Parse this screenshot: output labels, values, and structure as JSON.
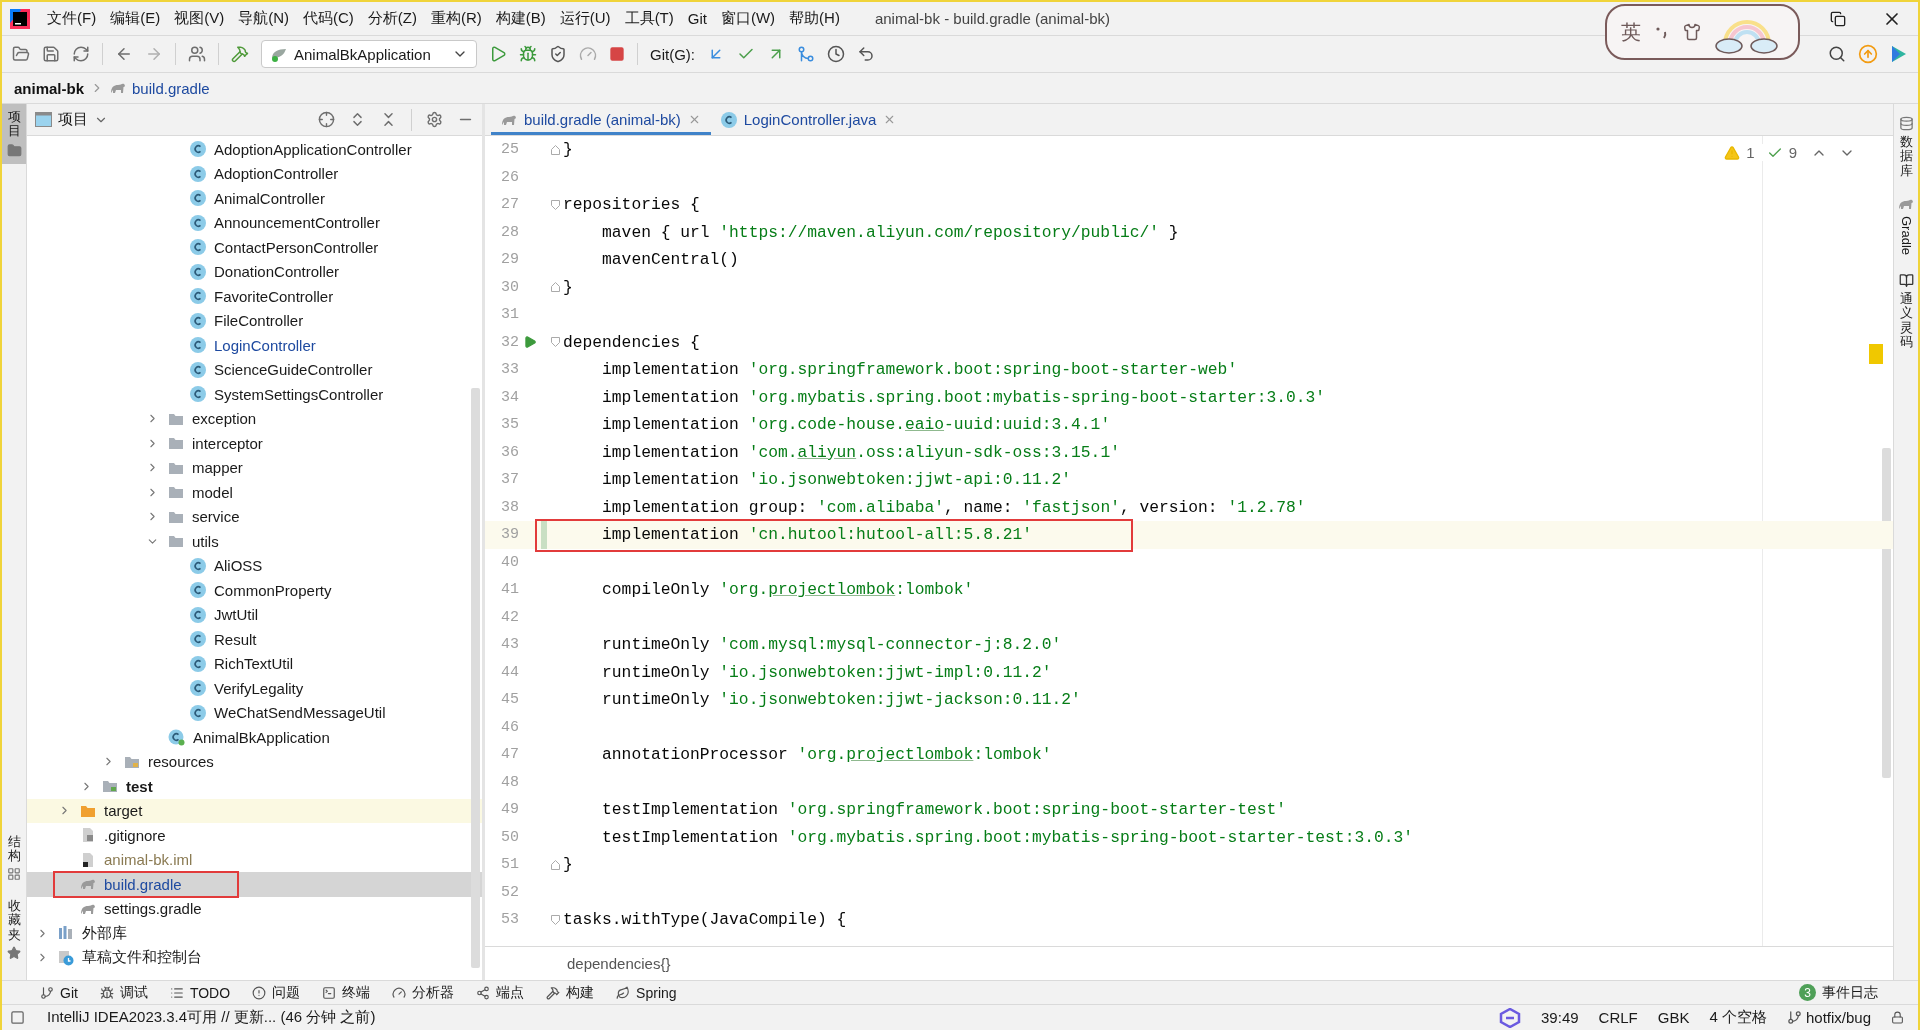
{
  "window": {
    "title": "animal-bk - build.gradle (animal-bk)"
  },
  "menu": [
    "文件(F)",
    "编辑(E)",
    "视图(V)",
    "导航(N)",
    "代码(C)",
    "分析(Z)",
    "重构(R)",
    "构建(B)",
    "运行(U)",
    "工具(T)",
    "Git",
    "窗口(W)",
    "帮助(H)"
  ],
  "ime": {
    "label": "英"
  },
  "toolbar": {
    "run_config": "AnimalBkApplication",
    "git_label": "Git(G):"
  },
  "breadcrumb": [
    "animal-bk",
    "build.gradle"
  ],
  "left_tool_windows": [
    {
      "label": "项目",
      "selected": true
    },
    {
      "label": "结构",
      "selected": false
    },
    {
      "label": "收藏夹",
      "selected": false
    }
  ],
  "right_tool_windows": [
    {
      "label": "数据库",
      "kind": "cjk"
    },
    {
      "label": "Gradle",
      "kind": "latin"
    },
    {
      "label": "通义灵码",
      "kind": "cjk"
    }
  ],
  "project_panel": {
    "title": "项目",
    "tree": [
      {
        "kind": "hidden",
        "children": [
          {
            "kind": "hidden",
            "children": [
              {
                "kind": "hidden",
                "children": [
                  {
                    "kind": "hidden",
                    "children": [
                      {
                        "kind": "hidden",
                        "children": [
                          {
                            "kind": "hidden",
                            "children": [
                              {
                                "label": "AdoptionApplicationController",
                                "kind": "class",
                                "selected": false
                              },
                              {
                                "label": "AdoptionController",
                                "kind": "class",
                                "selected": false
                              },
                              {
                                "label": "AnimalController",
                                "kind": "class",
                                "selected": false
                              },
                              {
                                "label": "AnnouncementController",
                                "kind": "class",
                                "selected": false
                              },
                              {
                                "label": "ContactPersonController",
                                "kind": "class",
                                "selected": false
                              },
                              {
                                "label": "DonationController",
                                "kind": "class",
                                "selected": false
                              },
                              {
                                "label": "FavoriteController",
                                "kind": "class",
                                "selected": false
                              },
                              {
                                "label": "FileController",
                                "kind": "class",
                                "selected": false
                              },
                              {
                                "label": "LoginController",
                                "kind": "class",
                                "selected": false,
                                "color": "#1e4aa0"
                              },
                              {
                                "label": "ScienceGuideController",
                                "kind": "class",
                                "selected": false
                              },
                              {
                                "label": "SystemSettingsController",
                                "kind": "class",
                                "selected": false
                              }
                            ]
                          },
                          {
                            "label": "exception",
                            "kind": "package",
                            "expanded": false,
                            "selected": false
                          },
                          {
                            "label": "interceptor",
                            "kind": "package",
                            "expanded": false,
                            "selected": false
                          },
                          {
                            "label": "mapper",
                            "kind": "package",
                            "expanded": false,
                            "selected": false
                          },
                          {
                            "label": "model",
                            "kind": "package",
                            "expanded": false,
                            "selected": false
                          },
                          {
                            "label": "service",
                            "kind": "package",
                            "expanded": false,
                            "selected": false
                          },
                          {
                            "label": "utils",
                            "kind": "package",
                            "expanded": true,
                            "selected": false,
                            "children": [
                              {
                                "label": "AliOSS",
                                "kind": "class",
                                "selected": false
                              },
                              {
                                "label": "CommonProperty",
                                "kind": "class",
                                "selected": false
                              },
                              {
                                "label": "JwtUtil",
                                "kind": "class",
                                "selected": false
                              },
                              {
                                "label": "Result",
                                "kind": "class",
                                "selected": false
                              },
                              {
                                "label": "RichTextUtil",
                                "kind": "class",
                                "selected": false
                              },
                              {
                                "label": "VerifyLegality",
                                "kind": "class",
                                "selected": false
                              },
                              {
                                "label": "WeChatSendMessageUtil",
                                "kind": "class",
                                "selected": false
                              }
                            ]
                          },
                          {
                            "label": "AnimalBkApplication",
                            "kind": "app_class",
                            "selected": false
                          }
                        ]
                      }
                    ]
                  },
                  {
                    "label": "resources",
                    "kind": "resources_folder",
                    "expanded": false,
                    "selected": false
                  }
                ]
              },
              {
                "label": "test",
                "kind": "test_folder",
                "expanded": false,
                "selected": false
              }
            ]
          },
          {
            "label": "target",
            "kind": "excluded_folder",
            "expanded": false,
            "selected": false
          },
          {
            "label": ".gitignore",
            "kind": "file",
            "selected": false
          },
          {
            "label": "animal-bk.iml",
            "kind": "module_file",
            "selected": false,
            "color": "#8a7a52"
          },
          {
            "label": "build.gradle",
            "kind": "gradle_file",
            "selected": true,
            "color": "#1e4aa0",
            "annotated": true
          },
          {
            "label": "settings.gradle",
            "kind": "gradle_file",
            "selected": false
          }
        ]
      },
      {
        "label": "外部库",
        "kind": "library",
        "expanded": false,
        "selected": false
      },
      {
        "label": "草稿文件和控制台",
        "kind": "scratch",
        "expanded": false,
        "selected": false
      }
    ]
  },
  "editor": {
    "tabs": [
      {
        "label": "build.gradle (animal-bk)",
        "kind": "gradle",
        "selected": true
      },
      {
        "label": "LoginController.java",
        "kind": "class",
        "selected": false
      }
    ],
    "inspections": {
      "warnings": "1",
      "checks": "9"
    },
    "lines": [
      {
        "number": "25",
        "kind": "block_end",
        "run": false,
        "current": false,
        "changed": false,
        "annotated": false,
        "tokens": [
          {
            "kind": "plain",
            "text": "}"
          }
        ]
      },
      {
        "number": "26",
        "run": false,
        "current": false,
        "changed": false,
        "annotated": false
      },
      {
        "number": "27",
        "kind": "block_start",
        "run": false,
        "current": false,
        "changed": false,
        "annotated": false,
        "tokens": [
          {
            "kind": "plain",
            "text": "repositories {"
          }
        ]
      },
      {
        "number": "28",
        "run": false,
        "current": false,
        "changed": false,
        "annotated": false,
        "tokens": [
          {
            "kind": "plain",
            "text": "    maven { url "
          },
          {
            "kind": "string",
            "text": "'https://maven.aliyun.com/repository/public/'"
          },
          {
            "kind": "plain",
            "text": " }"
          }
        ]
      },
      {
        "number": "29",
        "run": false,
        "current": false,
        "changed": false,
        "annotated": false,
        "tokens": [
          {
            "kind": "plain",
            "text": "    mavenCentral()"
          }
        ]
      },
      {
        "number": "30",
        "kind": "block_end",
        "run": false,
        "current": false,
        "changed": false,
        "annotated": false,
        "tokens": [
          {
            "kind": "plain",
            "text": "}"
          }
        ]
      },
      {
        "number": "31",
        "run": false,
        "current": false,
        "changed": false,
        "annotated": false
      },
      {
        "number": "32",
        "kind": "block_start",
        "run": true,
        "current": false,
        "changed": false,
        "annotated": false,
        "tokens": [
          {
            "kind": "plain",
            "text": "dependencies {"
          }
        ]
      },
      {
        "number": "33",
        "run": false,
        "current": false,
        "changed": false,
        "annotated": false,
        "tokens": [
          {
            "kind": "plain",
            "text": "    implementation "
          },
          {
            "kind": "string",
            "text": "'org.springframework.boot:spring-boot-starter-web'"
          }
        ]
      },
      {
        "number": "34",
        "run": false,
        "current": false,
        "changed": false,
        "annotated": false,
        "tokens": [
          {
            "kind": "plain",
            "text": "    implementation "
          },
          {
            "kind": "string",
            "text": "'org.mybatis.spring.boot:mybatis-spring-boot-starter:3.0.3'"
          }
        ]
      },
      {
        "number": "35",
        "run": false,
        "current": false,
        "changed": false,
        "annotated": false,
        "tokens": [
          {
            "kind": "plain",
            "text": "    implementation "
          },
          {
            "kind": "string",
            "text": "'org.code-house."
          },
          {
            "kind": "string_typo",
            "text": "eaio"
          },
          {
            "kind": "string",
            "text": "-uuid:uuid:3.4.1'"
          }
        ]
      },
      {
        "number": "36",
        "run": false,
        "current": false,
        "changed": false,
        "annotated": false,
        "tokens": [
          {
            "kind": "plain",
            "text": "    implementation "
          },
          {
            "kind": "string",
            "text": "'com."
          },
          {
            "kind": "string_typo",
            "text": "aliyun"
          },
          {
            "kind": "string",
            "text": ".oss:aliyun-sdk-oss:3.15.1'"
          }
        ]
      },
      {
        "number": "37",
        "run": false,
        "current": false,
        "changed": false,
        "annotated": false,
        "tokens": [
          {
            "kind": "plain",
            "text": "    implementation "
          },
          {
            "kind": "string",
            "text": "'io.jsonwebtoken:jjwt-api:0.11.2'"
          }
        ]
      },
      {
        "number": "38",
        "run": false,
        "current": false,
        "changed": false,
        "annotated": false,
        "tokens": [
          {
            "kind": "plain",
            "text": "    implementation group: "
          },
          {
            "kind": "string",
            "text": "'com.alibaba'"
          },
          {
            "kind": "plain",
            "text": ", name: "
          },
          {
            "kind": "string",
            "text": "'fastjson'"
          },
          {
            "kind": "plain",
            "text": ", version: "
          },
          {
            "kind": "string",
            "text": "'1.2.78'"
          }
        ]
      },
      {
        "number": "39",
        "run": false,
        "current": true,
        "changed": true,
        "annotated": true,
        "tokens": [
          {
            "kind": "plain",
            "text": "    implementation "
          },
          {
            "kind": "string",
            "text": "'cn.hutool:hutool-all:5.8.21'"
          }
        ]
      },
      {
        "number": "40",
        "run": false,
        "current": false,
        "changed": false,
        "annotated": false
      },
      {
        "number": "41",
        "run": false,
        "current": false,
        "changed": false,
        "annotated": false,
        "tokens": [
          {
            "kind": "plain",
            "text": "    compileOnly "
          },
          {
            "kind": "string",
            "text": "'org."
          },
          {
            "kind": "string_typo",
            "text": "projectlombok"
          },
          {
            "kind": "string",
            "text": ":lombok'"
          }
        ]
      },
      {
        "number": "42",
        "run": false,
        "current": false,
        "changed": false,
        "annotated": false
      },
      {
        "number": "43",
        "run": false,
        "current": false,
        "changed": false,
        "annotated": false,
        "tokens": [
          {
            "kind": "plain",
            "text": "    runtimeOnly "
          },
          {
            "kind": "string",
            "text": "'com.mysql:mysql-connector-j:8.2.0'"
          }
        ]
      },
      {
        "number": "44",
        "run": false,
        "current": false,
        "changed": false,
        "annotated": false,
        "tokens": [
          {
            "kind": "plain",
            "text": "    runtimeOnly "
          },
          {
            "kind": "string",
            "text": "'io.jsonwebtoken:jjwt-impl:0.11.2'"
          }
        ]
      },
      {
        "number": "45",
        "run": false,
        "current": false,
        "changed": false,
        "annotated": false,
        "tokens": [
          {
            "kind": "plain",
            "text": "    runtimeOnly "
          },
          {
            "kind": "string",
            "text": "'io.jsonwebtoken:jjwt-jackson:0.11.2'"
          }
        ]
      },
      {
        "number": "46",
        "run": false,
        "current": false,
        "changed": false,
        "annotated": false
      },
      {
        "number": "47",
        "run": false,
        "current": false,
        "changed": false,
        "annotated": false,
        "tokens": [
          {
            "kind": "plain",
            "text": "    annotationProcessor "
          },
          {
            "kind": "string",
            "text": "'org."
          },
          {
            "kind": "string_typo",
            "text": "projectlombok"
          },
          {
            "kind": "string",
            "text": ":lombok'"
          }
        ]
      },
      {
        "number": "48",
        "run": false,
        "current": false,
        "changed": false,
        "annotated": false
      },
      {
        "number": "49",
        "run": false,
        "current": false,
        "changed": false,
        "annotated": false,
        "tokens": [
          {
            "kind": "plain",
            "text": "    testImplementation "
          },
          {
            "kind": "string",
            "text": "'org.springframework.boot:spring-boot-starter-test'"
          }
        ]
      },
      {
        "number": "50",
        "run": false,
        "current": false,
        "changed": false,
        "annotated": false,
        "tokens": [
          {
            "kind": "plain",
            "text": "    testImplementation "
          },
          {
            "kind": "string",
            "text": "'org.mybatis.spring.boot:mybatis-spring-boot-starter-test:3.0.3'"
          }
        ]
      },
      {
        "number": "51",
        "kind": "block_end",
        "run": false,
        "current": false,
        "changed": false,
        "annotated": false,
        "tokens": [
          {
            "kind": "plain",
            "text": "}"
          }
        ]
      },
      {
        "number": "52",
        "run": false,
        "current": false,
        "changed": false,
        "annotated": false
      },
      {
        "number": "53",
        "kind": "block_start",
        "run": false,
        "current": false,
        "changed": false,
        "annotated": false,
        "tokens": [
          {
            "kind": "plain",
            "text": "tasks.withType(JavaCompile) {"
          }
        ]
      }
    ],
    "breadcrumb": "dependencies{}"
  },
  "bottom_tools": [
    "Git",
    "调试",
    "TODO",
    "问题",
    "终端",
    "分析器",
    "端点",
    "构建",
    "Spring"
  ],
  "event_log": {
    "count": "3",
    "label": "事件日志"
  },
  "status_bar": {
    "message": "IntelliJ IDEA2023.3.4可用 // 更新... (46 分钟 之前)",
    "position": "39:49",
    "line_separator": "CRLF",
    "encoding": "GBK",
    "indent": "4 个空格",
    "branch": "hotfix/bug"
  }
}
